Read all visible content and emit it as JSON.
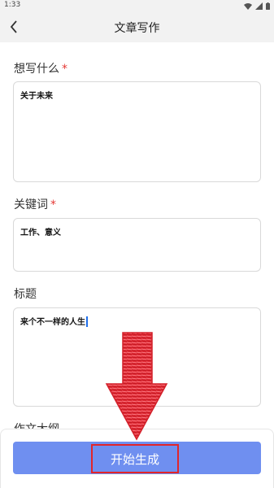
{
  "status_bar": {
    "time": "1:33"
  },
  "app_bar": {
    "title": "文章写作"
  },
  "fields": {
    "topic": {
      "label": "想写什么",
      "required_mark": "*",
      "value": "关于未来"
    },
    "keywords": {
      "label": "关键词",
      "required_mark": "*",
      "value": "工作、意义"
    },
    "title": {
      "label": "标题",
      "value": "来个不一样的人生"
    },
    "outline": {
      "label": "作文大纲"
    }
  },
  "actions": {
    "generate_label": "开始生成"
  },
  "colors": {
    "accent": "#6f8ff0",
    "required": "#e53935",
    "annotation": "#e1252a"
  },
  "icons": {
    "back": "chevron-left-icon",
    "wifi": "wifi-icon",
    "signal": "signal-icon",
    "battery": "battery-icon"
  }
}
